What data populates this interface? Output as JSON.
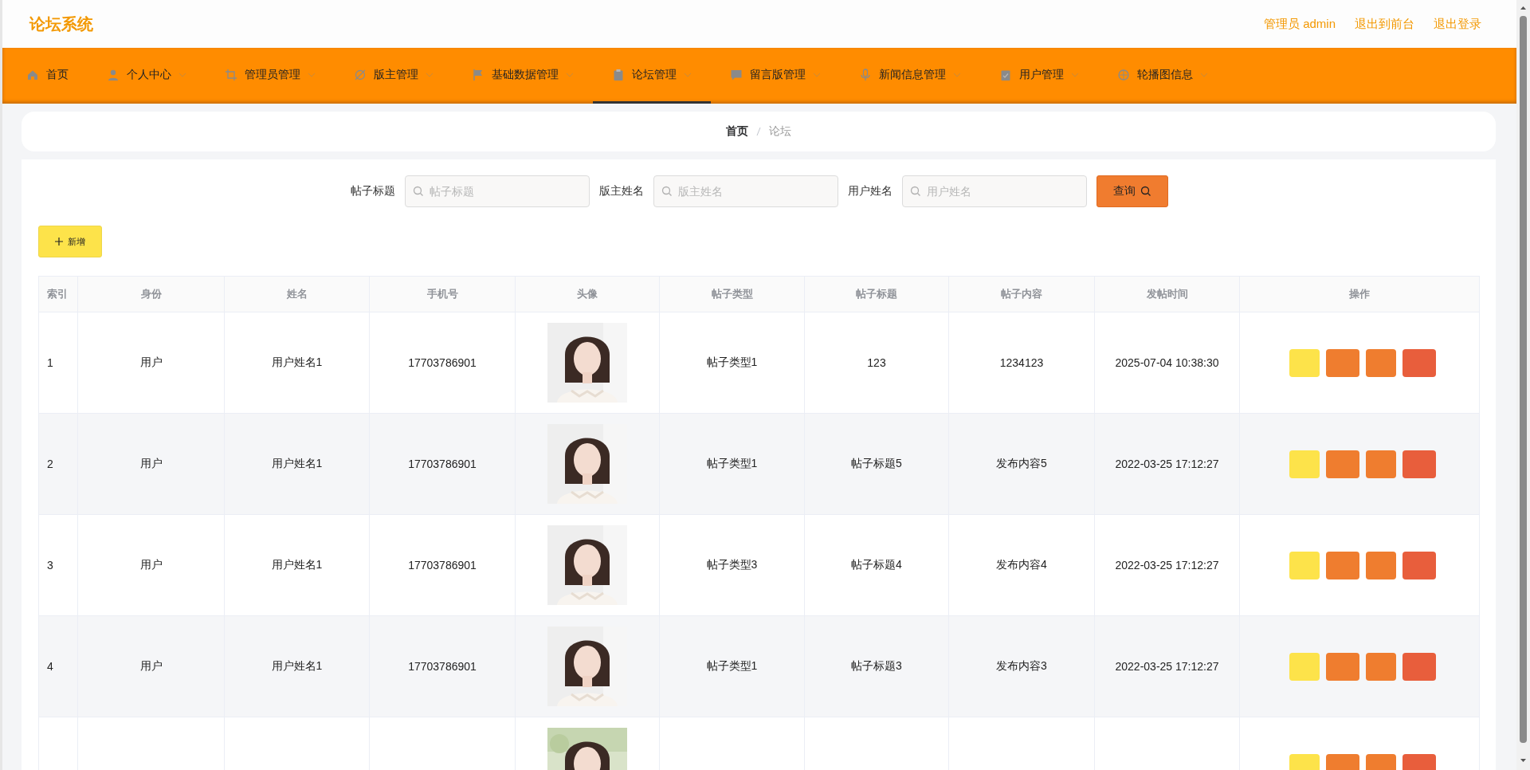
{
  "header": {
    "title": "论坛系统",
    "links": [
      "管理员 admin",
      "退出到前台",
      "退出登录"
    ]
  },
  "nav": [
    {
      "label": "首页",
      "dropdown": false,
      "selected": false
    },
    {
      "label": "个人中心",
      "dropdown": true,
      "selected": false
    },
    {
      "label": "管理员管理",
      "dropdown": true,
      "selected": false
    },
    {
      "label": "版主管理",
      "dropdown": true,
      "selected": false
    },
    {
      "label": "基础数据管理",
      "dropdown": true,
      "selected": false
    },
    {
      "label": "论坛管理",
      "dropdown": true,
      "selected": true
    },
    {
      "label": "留言版管理",
      "dropdown": true,
      "selected": false
    },
    {
      "label": "新闻信息管理",
      "dropdown": true,
      "selected": false
    },
    {
      "label": "用户管理",
      "dropdown": true,
      "selected": false
    },
    {
      "label": "轮播图信息",
      "dropdown": true,
      "selected": false
    }
  ],
  "breadcrumb": [
    "首页",
    "论坛"
  ],
  "search": {
    "fields": [
      {
        "label": "帖子标题",
        "placeholder": "帖子标题"
      },
      {
        "label": "版主姓名",
        "placeholder": "版主姓名"
      },
      {
        "label": "用户姓名",
        "placeholder": "用户姓名"
      }
    ],
    "button": "查询"
  },
  "add_button": "新增",
  "table": {
    "columns": [
      "索引",
      "身份",
      "姓名",
      "手机号",
      "头像",
      "帖子类型",
      "帖子标题",
      "帖子内容",
      "发帖时间",
      "操作"
    ],
    "rows": [
      {
        "index": "1",
        "identity": "用户",
        "name": "用户姓名1",
        "phone": "17703786901",
        "avatar": {
          "kind": "picture"
        },
        "type": "帖子类型1",
        "title": "123",
        "content": "1234123",
        "time": "2025-07-04 10:38:30",
        "actions": [
          {
            "color": "#fde34a"
          },
          {
            "color": "#ef7d2f"
          },
          {
            "color": "#ef7d2f"
          },
          {
            "color": "#e85e3c"
          }
        ]
      },
      {
        "index": "2",
        "identity": "用户",
        "name": "用户姓名1",
        "phone": "17703786901",
        "avatar": {
          "kind": "picture"
        },
        "type": "帖子类型1",
        "title": "帖子标题5",
        "content": "发布内容5",
        "time": "2022-03-25 17:12:27",
        "actions": [
          {
            "color": "#fde34a"
          },
          {
            "color": "#ef7d2f"
          },
          {
            "color": "#ef7d2f"
          },
          {
            "color": "#e85e3c"
          }
        ]
      },
      {
        "index": "3",
        "identity": "用户",
        "name": "用户姓名1",
        "phone": "17703786901",
        "avatar": {
          "kind": "picture"
        },
        "type": "帖子类型3",
        "title": "帖子标题4",
        "content": "发布内容4",
        "time": "2022-03-25 17:12:27",
        "actions": [
          {
            "color": "#fde34a"
          },
          {
            "color": "#ef7d2f"
          },
          {
            "color": "#ef7d2f"
          },
          {
            "color": "#e85e3c"
          }
        ]
      },
      {
        "index": "4",
        "identity": "用户",
        "name": "用户姓名1",
        "phone": "17703786901",
        "avatar": {
          "kind": "picture"
        },
        "type": "帖子类型1",
        "title": "帖子标题3",
        "content": "发布内容3",
        "time": "2022-03-25 17:12:27",
        "actions": [
          {
            "color": "#fde34a"
          },
          {
            "color": "#ef7d2f"
          },
          {
            "color": "#ef7d2f"
          },
          {
            "color": "#e85e3c"
          }
        ]
      },
      {
        "avatar": {
          "kind": "picture"
        },
        "actions": [
          {
            "color": "#fde34a"
          },
          {
            "color": "#ef7d2f"
          },
          {
            "color": "#ef7d2f"
          },
          {
            "color": "#e85e3c"
          }
        ]
      }
    ]
  }
}
